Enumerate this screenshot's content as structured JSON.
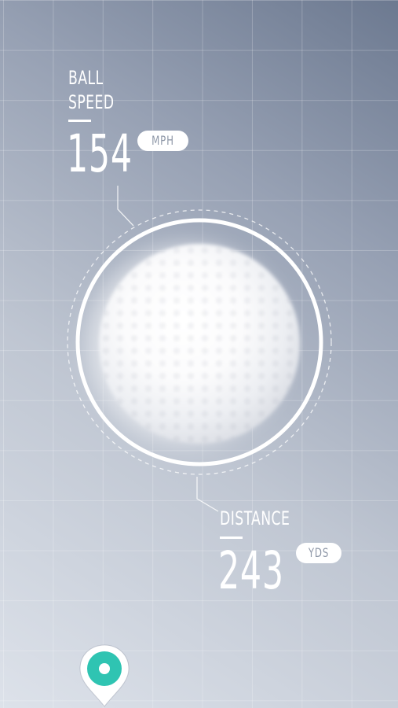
{
  "ball_speed": {
    "label_line1": "BALL",
    "label_line2": "SPEED",
    "value": "154",
    "unit": "MPH"
  },
  "distance": {
    "label": "DISTANCE",
    "value": "243",
    "unit": "YDS"
  },
  "colors": {
    "accent_teal": "#2fc4b2",
    "text": "#ffffff",
    "unit_text": "#8f98a8"
  },
  "icons": {
    "ball": "golf-ball-icon",
    "pin": "location-pin-icon"
  }
}
